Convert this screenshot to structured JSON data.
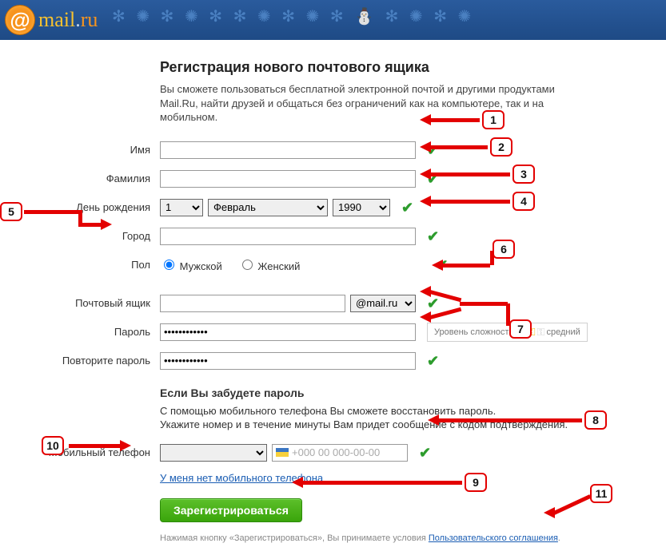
{
  "logo_text": "mail.ru",
  "title": "Регистрация нового почтового ящика",
  "intro": "Вы сможете пользоваться бесплатной электронной почтой и другими продуктами Mail.Ru, найти друзей и общаться без ограничений как на компьютере, так и на мобильном.",
  "labels": {
    "name": "Имя",
    "surname": "Фамилия",
    "birthday": "День рождения",
    "city": "Город",
    "gender": "Пол",
    "mailbox": "Почтовый ящик",
    "password": "Пароль",
    "password2": "Повторите пароль",
    "phone": "Мобильный телефон"
  },
  "birthday": {
    "day": "1",
    "month": "Февраль",
    "year": "1990"
  },
  "gender": {
    "male": "Мужской",
    "female": "Женский"
  },
  "domain": "@mail.ru",
  "strength": {
    "label": "Уровень сложности:",
    "value": "средний"
  },
  "forgot": {
    "title": "Если Вы забудете пароль",
    "desc1": "С помощью мобильного телефона Вы сможете восстановить пароль.",
    "desc2": "Укажите номер и в течение минуты Вам придет сообщение с кодом подтверждения."
  },
  "phone_placeholder": "+000 00 000-00-00",
  "no_phone_link": "У меня нет мобильного телефона",
  "submit": "Зарегистрироваться",
  "footnote_prefix": "Нажимая кнопку «Зарегистрироваться», Вы принимаете условия ",
  "footnote_link": "Пользовательского соглашения",
  "annotations": {
    "n1": "1",
    "n2": "2",
    "n3": "3",
    "n4": "4",
    "n5": "5",
    "n6": "6",
    "n7": "7",
    "n8": "8",
    "n9": "9",
    "n10": "10",
    "n11": "11"
  }
}
